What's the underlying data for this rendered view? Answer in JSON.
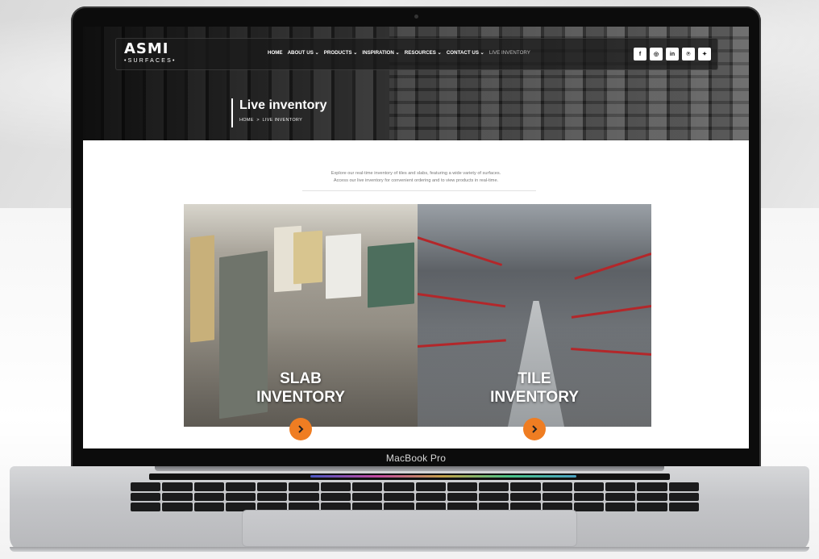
{
  "site": {
    "logo": {
      "main": "ASMI",
      "sub": "•SURFACES•"
    },
    "nav": {
      "items": [
        {
          "label": "HOME"
        },
        {
          "label": "ABOUT US ⌄"
        },
        {
          "label": "PRODUCTS ⌄"
        },
        {
          "label": "INSPIRATION ⌄"
        },
        {
          "label": "RESOURCES ⌄"
        },
        {
          "label": "CONTACT US ⌄"
        },
        {
          "label": "LIVE INVENTORY"
        }
      ]
    },
    "socials": [
      {
        "icon": "facebook-icon",
        "glyph": "f"
      },
      {
        "icon": "instagram-icon",
        "glyph": "◎"
      },
      {
        "icon": "linkedin-icon",
        "glyph": "in"
      },
      {
        "icon": "pinterest-icon",
        "glyph": "℗"
      },
      {
        "icon": "twitter-icon",
        "glyph": "✦"
      }
    ],
    "hero": {
      "title": "Live inventory",
      "breadcrumb": {
        "home": "HOME",
        "separator": ">",
        "current": "LIVE INVENTORY"
      }
    },
    "intro": {
      "line1": "Explore our real-time inventory of tiles and slabs, featuring a wide variety of surfaces.",
      "line2": "Access our live inventory for convenient ordering and to view products in real-time."
    },
    "cards": [
      {
        "line1": "SLAB",
        "line2": "INVENTORY"
      },
      {
        "line1": "TILE",
        "line2": "INVENTORY"
      }
    ],
    "accent": "#ef7d22"
  },
  "device": {
    "label": "MacBook Pro"
  }
}
